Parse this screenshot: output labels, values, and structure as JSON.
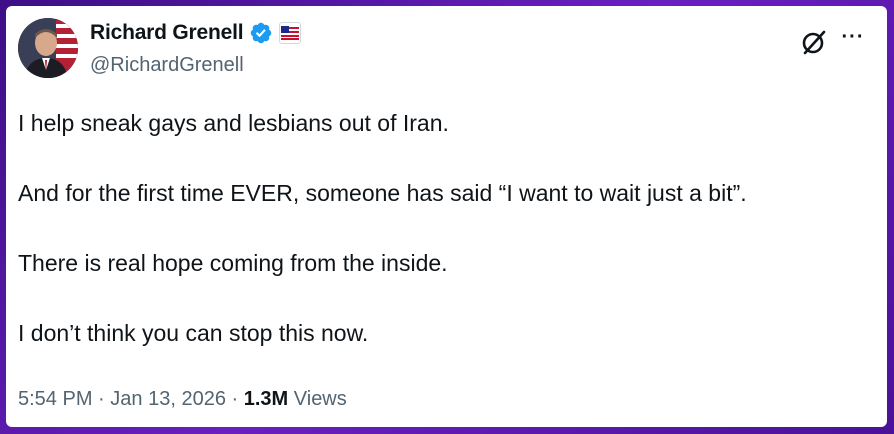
{
  "author": {
    "display_name": "Richard Grenell",
    "handle": "@RichardGrenell",
    "verified": true,
    "avatar_icon": "profile-photo",
    "affiliation_icon": "affiliation-badge"
  },
  "tweet": {
    "paragraphs": [
      "I help sneak gays and lesbians out of Iran.",
      "And for the first time EVER, someone has said “I want to wait just a bit”.",
      "There is real hope coming from the inside.",
      "I don’t think you can stop this now."
    ]
  },
  "meta": {
    "time": "5:54 PM",
    "separator": "·",
    "date": "Jan 13, 2026",
    "views_count": "1.3M",
    "views_label": "Views"
  },
  "actions": {
    "grok_icon": "grok-icon",
    "more_icon": "more-icon",
    "more_label": "···"
  },
  "colors": {
    "frame": "#5a1aa8",
    "verified_blue": "#1d9bf0",
    "text_primary": "#0f1419",
    "text_secondary": "#536471"
  }
}
